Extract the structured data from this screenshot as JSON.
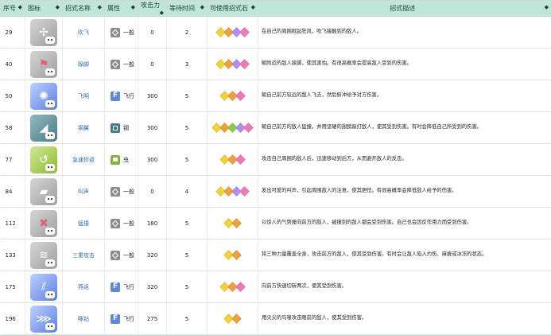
{
  "headers": {
    "no": "序号",
    "icon": "图标",
    "name": "招式名称",
    "attr": "属性",
    "power": "攻击力",
    "wait": "等待时间",
    "stones": "可使用招式石",
    "desc": "招式描述",
    "sort_icon": "◆"
  },
  "stone_colors": {
    "yellow": "#f2d33a",
    "orange": "#f0a23a",
    "purple": "#b38ef0",
    "pink": "#f07ab8",
    "green": "#8ccc4a",
    "blue": "#6a9ff0"
  },
  "rows": [
    {
      "no": "29",
      "icon_color": "gray",
      "icon": "whirlwind-icon",
      "name": "吹飞",
      "attr_type": "normal",
      "attr": "一般",
      "power": "0",
      "wait": "2",
      "stones": [
        "yellow",
        "orange",
        "purple",
        "pink"
      ],
      "desc": "在自己的周围掀起狂风，吹飞接触到的敌人。"
    },
    {
      "no": "40",
      "icon_color": "gray",
      "icon": "stomp-icon",
      "name": "跺脚",
      "attr_type": "normal",
      "attr": "一般",
      "power": "0",
      "wait": "3",
      "stones": [
        "yellow",
        "orange",
        "purple",
        "pink"
      ],
      "desc": "朝附近的敌人跺脚，使其害怕。有很高概率会提高敌人受到的伤害。"
    },
    {
      "no": "50",
      "icon_color": "blue",
      "icon": "air-slash-icon",
      "name": "飞明",
      "attr_type": "fly",
      "attr": "飞行",
      "power": "300",
      "wait": "5",
      "stones": [
        "yellow",
        "orange",
        "pink"
      ],
      "desc": "朝自己前方较远的敌人飞去，然后俯冲给予对方伤害。"
    },
    {
      "no": "58",
      "icon_color": "teal",
      "icon": "iron-tail-icon",
      "name": "钢翼",
      "attr_type": "steel",
      "attr": "钢",
      "power": "300",
      "wait": "5",
      "stones": [
        "yellow",
        "orange",
        "green",
        "purple",
        "pink"
      ],
      "desc": "朝自己前方的敌人猛撞，并用坚硬的翅膀敲打敌人，使其受到伤害。有时会降低自己所受到的伤害。"
    },
    {
      "no": "77",
      "icon_color": "green",
      "icon": "u-turn-icon",
      "name": "急速折返",
      "attr_type": "bug",
      "attr": "虫",
      "power": "300",
      "wait": "5",
      "stones": [
        "yellow",
        "orange",
        "pink"
      ],
      "desc": "攻击自己周围的敌人后，迅速移动到后方，从而避开敌人的反击。"
    },
    {
      "no": "84",
      "icon_color": "gray",
      "icon": "growl-icon",
      "name": "叫声",
      "attr_type": "normal",
      "attr": "一般",
      "power": "0",
      "wait": "4",
      "stones": [
        "yellow",
        "orange",
        "purple",
        "pink"
      ],
      "desc": "发出可爱的叫声，引起周围敌人的注意，使其胆怯。有很高概率会降低敌人给予的伤害。"
    },
    {
      "no": "112",
      "icon_color": "gray",
      "icon": "double-edge-icon",
      "name": "猛撞",
      "attr_type": "normal",
      "attr": "一般",
      "power": "180",
      "wait": "5",
      "stones": [
        "yellow",
        "orange"
      ],
      "desc": "以惊人的气势撞向前方的敌人，被撞到的敌人都会受到伤害。自己也会因反作用力而受到伤害。"
    },
    {
      "no": "133",
      "icon_color": "gray",
      "icon": "tri-attack-icon",
      "name": "三重攻击",
      "attr_type": "normal",
      "attr": "一般",
      "power": "320",
      "wait": "5",
      "stones": [
        "yellow",
        "orange"
      ],
      "desc": "将三种力量覆盖全身，攻击前方的敌人，使其受到伤害。有时会让敌人陷入灼伤、麻痹或冰冻的状态。"
    },
    {
      "no": "175",
      "icon_color": "blue",
      "icon": "slash-icon",
      "name": "燕返",
      "attr_type": "fly",
      "attr": "飞行",
      "power": "320",
      "wait": "5",
      "stones": [
        "yellow",
        "orange",
        "pink"
      ],
      "desc": "向前方快速切斩两次，使其受到伤害。"
    },
    {
      "no": "196",
      "icon_color": "blue",
      "icon": "peck-icon",
      "name": "啄钻",
      "attr_type": "fly",
      "attr": "飞行",
      "power": "275",
      "wait": "5",
      "stones": [
        "yellow",
        "orange"
      ],
      "desc": "用尖尖的鸟喙攻击眼前的敌人，使其受到伤害。"
    }
  ]
}
